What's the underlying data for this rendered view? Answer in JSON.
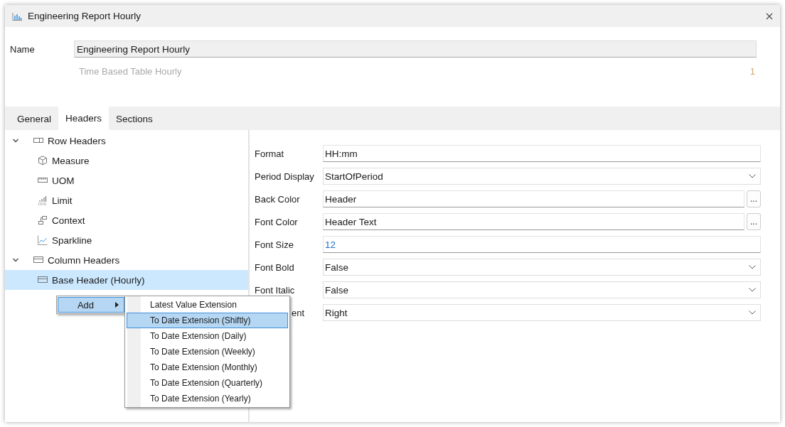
{
  "window": {
    "title": "Engineering Report Hourly"
  },
  "name_field": {
    "label": "Name",
    "value": "Engineering Report Hourly"
  },
  "subtitle": "Time Based Table Hourly",
  "count": "1",
  "tabs": [
    {
      "label": "General",
      "selected": false
    },
    {
      "label": "Headers",
      "selected": true
    },
    {
      "label": "Sections",
      "selected": false
    }
  ],
  "tree": [
    {
      "label": "Row Headers",
      "kind": "row-header",
      "expanded": true,
      "selected": false,
      "children": [
        {
          "label": "Measure",
          "kind": "cube",
          "selected": false
        },
        {
          "label": "UOM",
          "kind": "ruler",
          "selected": false
        },
        {
          "label": "Limit",
          "kind": "limit",
          "selected": false
        },
        {
          "label": "Context",
          "kind": "context",
          "selected": false
        },
        {
          "label": "Sparkline",
          "kind": "sparkline",
          "selected": false
        }
      ]
    },
    {
      "label": "Column Headers",
      "kind": "column-header",
      "expanded": true,
      "selected": false,
      "children": [
        {
          "label": "Base Header (Hourly)",
          "kind": "column-header",
          "selected": true
        }
      ]
    }
  ],
  "properties": [
    {
      "label": "Format",
      "kind": "text",
      "value": "HH:mm",
      "covered": false
    },
    {
      "label": "Period Display",
      "kind": "dropdown",
      "value": "StartOfPeriod",
      "covered": false
    },
    {
      "label": "Back Color",
      "kind": "picker",
      "value": "Header",
      "button": "...",
      "covered": false
    },
    {
      "label": "Font Color",
      "kind": "picker",
      "value": "Header Text",
      "button": "...",
      "covered": false
    },
    {
      "label": "Font Size",
      "kind": "number",
      "value": "12",
      "covered": false
    },
    {
      "label": "Font Bold",
      "kind": "dropdown",
      "value": "False",
      "covered": false
    },
    {
      "label": "Font Italic",
      "kind": "dropdown",
      "value": "False",
      "covered": false
    },
    {
      "label": "ent",
      "kind": "dropdown",
      "value": "Right",
      "covered": true
    }
  ],
  "context_menu": {
    "items": [
      {
        "label": "Add",
        "selected": true
      }
    ],
    "submenu": [
      {
        "label": "Latest Value Extension",
        "selected": false
      },
      {
        "label": "To Date Extension (Shiftly)",
        "selected": true
      },
      {
        "label": "To Date Extension (Daily)",
        "selected": false
      },
      {
        "label": "To Date Extension (Weekly)",
        "selected": false
      },
      {
        "label": "To Date Extension (Monthly)",
        "selected": false
      },
      {
        "label": "To Date Extension (Quarterly)",
        "selected": false
      },
      {
        "label": "To Date Extension (Yearly)",
        "selected": false
      }
    ]
  }
}
